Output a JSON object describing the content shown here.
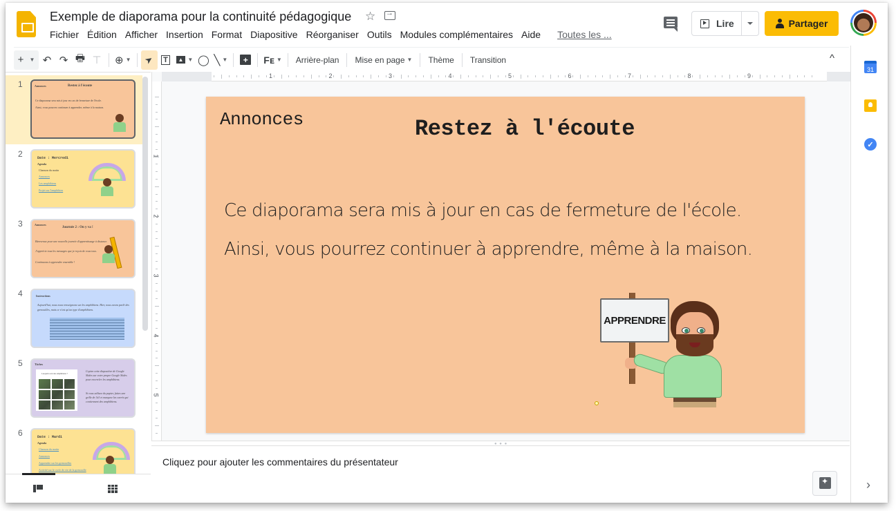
{
  "header": {
    "doc_title": "Exemple de diaporama pour la continuité pédagogique",
    "icons": {
      "logo": "google-slides-logo",
      "star": "star-icon",
      "move": "move-to-folder-icon"
    },
    "menu": [
      "Fichier",
      "Édition",
      "Afficher",
      "Insertion",
      "Format",
      "Diapositive",
      "Réorganiser",
      "Outils",
      "Modules complémentaires",
      "Aide"
    ],
    "last_edit": "Toutes les ...",
    "present_label": "Lire",
    "share_label": "Partager",
    "star_glyph": "☆"
  },
  "toolbar": {
    "add": "+",
    "undo": "↶",
    "redo": "↷",
    "print": "🖶",
    "paint_format": "⊤",
    "zoom": "⊕",
    "select": "➤",
    "textbox": "T",
    "image": "▲",
    "shape": "◯",
    "line": "╲",
    "comment_add": "+",
    "font_ff": "Fᴇ",
    "background": "Arrière-plan",
    "layout": "Mise en page",
    "theme": "Thème",
    "transition": "Transition",
    "collapse": "^"
  },
  "rulers": {
    "horizontal": [
      "1",
      "2",
      "3",
      "4",
      "5",
      "6",
      "7",
      "8",
      "9"
    ],
    "vertical": [
      "1",
      "2",
      "3",
      "4",
      "5"
    ]
  },
  "filmstrip": {
    "slides": [
      {
        "num": "1",
        "bg": "#f8c59a",
        "label": "Annonces",
        "title": "Restez à l'écoute",
        "lines": [
          "Ce diaporama sera mis à jour en cas de fermeture de l'école.",
          "Ainsi, vous pourrez continuer à apprendre, même à la maison."
        ],
        "selected": true
      },
      {
        "num": "2",
        "bg": "#fde293",
        "title": "Date : Mercredi",
        "subtitle": "Agenda",
        "lines": [
          "Chanson du matin",
          "Annonces",
          "Les amphibiens",
          "Projet sur l'amphibien"
        ]
      },
      {
        "num": "3",
        "bg": "#f8c59a",
        "label": "Annonces",
        "title": "Journée 2 : On y va !",
        "lines": [
          "Bienvenue pour une nouvelle journée d'apprentissage à distance.",
          "J'apprécie tous les messages que je reçois de vous tous.",
          "Continuons à apprendre ensemble !"
        ]
      },
      {
        "num": "4",
        "bg": "#c6dafc",
        "title": "Instructions",
        "lines": [
          "Aujourd'hui, nous nous renseignons sur les amphibiens. Hier, nous avons parlé des grenouilles, mais ce n'est qu'un type d'amphibiens."
        ]
      },
      {
        "num": "5",
        "bg": "#d7cdea",
        "title": "Tâches",
        "lines": [
          "Copiez cette diapositive de Google Slides sur votre propre Google Slides pour encercler les amphibiens.",
          "Si vous utilisez du papier, faites une grille de 3x3 et marquez les carrés qui contiennent des amphibiens."
        ],
        "card_title": "Lesquels sont des amphibiens ?"
      },
      {
        "num": "6",
        "bg": "#fde293",
        "title": "Date : Mardi",
        "subtitle": "Agenda",
        "lines": [
          "Chanson du matin",
          "Annonces",
          "Apprendre sur les grenouilles",
          "Activité sur le cycle de vie de la grenouille"
        ]
      }
    ]
  },
  "slide": {
    "label": "Annonces",
    "title": "Restez à l'écoute",
    "body": [
      "Ce diaporama sera mis à jour en cas de fermeture de l'école.",
      "Ainsi, vous pourrez continuer à apprendre, même à la maison."
    ],
    "sign_text": "APPRENDRE",
    "background": "#f8c59a"
  },
  "notes": {
    "placeholder": "Cliquez pour ajouter les commentaires du présentateur"
  },
  "side_panel": {
    "calendar_day": "31",
    "tasks_glyph": "✓",
    "expand": "›"
  },
  "colors": {
    "share": "#fbbc04",
    "selected_thumb": "#feefc3",
    "slide_bg": "#f8c59a"
  }
}
